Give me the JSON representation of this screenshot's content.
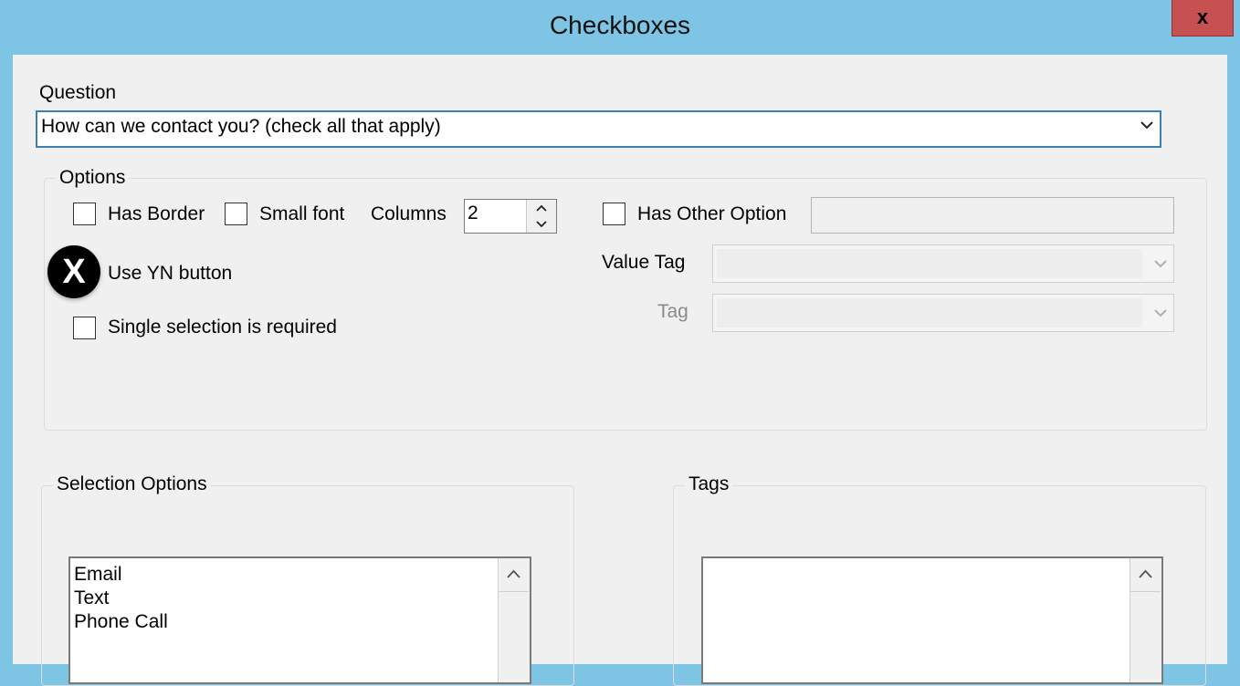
{
  "window": {
    "title": "Checkboxes",
    "close_label": "x"
  },
  "question": {
    "label": "Question",
    "value": "How can we contact you? (check all that apply)"
  },
  "options": {
    "legend": "Options",
    "has_border_label": "Has Border",
    "small_font_label": "Small font",
    "columns_label": "Columns",
    "columns_value": "2",
    "has_other_option_label": "Has Other Option",
    "use_yn_label": "Use YN button",
    "use_yn_badge": "X",
    "single_selection_label": "Single selection is required",
    "value_tag_label": "Value Tag",
    "tag_label": "Tag"
  },
  "selection_options": {
    "legend": "Selection Options",
    "items": [
      "Email",
      "Text",
      "Phone Call"
    ]
  },
  "tags": {
    "legend": "Tags"
  }
}
